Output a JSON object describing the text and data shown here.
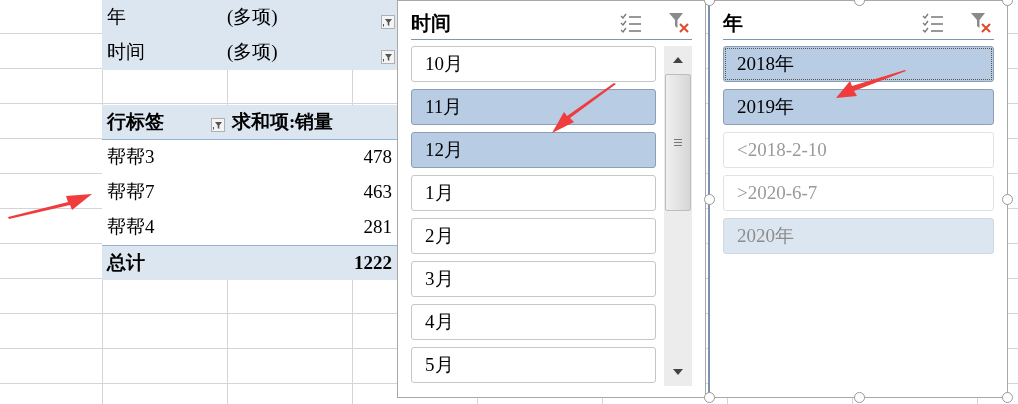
{
  "pivot": {
    "filters": [
      {
        "field": "年",
        "value": "(多项)"
      },
      {
        "field": "时间",
        "value": "(多项)"
      }
    ],
    "columns": [
      "行标签",
      "求和项:销量"
    ],
    "rows": [
      {
        "label": "帮帮3",
        "value": "478"
      },
      {
        "label": "帮帮7",
        "value": "463"
      },
      {
        "label": "帮帮4",
        "value": "281"
      }
    ],
    "total": {
      "label": "总计",
      "value": "1222"
    }
  },
  "slicers": [
    {
      "title": "时间",
      "selected": false,
      "scrollable": true,
      "items": [
        {
          "label": "10月",
          "selected": false,
          "has_data": true,
          "focused": false
        },
        {
          "label": "11月",
          "selected": true,
          "has_data": true,
          "focused": false
        },
        {
          "label": "12月",
          "selected": true,
          "has_data": true,
          "focused": false
        },
        {
          "label": "1月",
          "selected": false,
          "has_data": true,
          "focused": false
        },
        {
          "label": "2月",
          "selected": false,
          "has_data": true,
          "focused": false
        },
        {
          "label": "3月",
          "selected": false,
          "has_data": true,
          "focused": false
        },
        {
          "label": "4月",
          "selected": false,
          "has_data": true,
          "focused": false
        },
        {
          "label": "5月",
          "selected": false,
          "has_data": true,
          "focused": false
        }
      ]
    },
    {
      "title": "年",
      "selected": true,
      "scrollable": false,
      "items": [
        {
          "label": "2018年",
          "selected": true,
          "has_data": true,
          "focused": true
        },
        {
          "label": "2019年",
          "selected": true,
          "has_data": true,
          "focused": false
        },
        {
          "label": "<2018-2-10",
          "selected": false,
          "has_data": false,
          "focused": false
        },
        {
          "label": ">2020-6-7",
          "selected": false,
          "has_data": false,
          "focused": false
        },
        {
          "label": "2020年",
          "selected": true,
          "has_data": false,
          "focused": false
        }
      ]
    }
  ]
}
